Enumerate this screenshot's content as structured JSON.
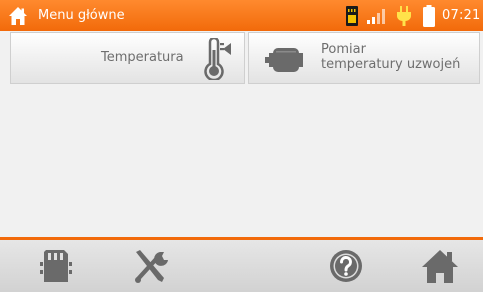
{
  "status_bar": {
    "title": "Menu główne",
    "time": "07:21",
    "icons": [
      "home-icon",
      "sd-card-icon",
      "signal-icon",
      "plug-icon",
      "battery-icon"
    ]
  },
  "menu": {
    "items": [
      {
        "label": "Temperatura",
        "icon": "thermometer-icon"
      },
      {
        "label_line1": "Pomiar",
        "label_line2": "temperatury uzwojeń",
        "icon": "motor-icon"
      }
    ]
  },
  "bottom_bar": {
    "buttons": [
      "memory-card-icon",
      "tools-icon",
      "help-icon",
      "home-icon"
    ]
  },
  "colors": {
    "accent": "#f26a0a",
    "icon_gray": "#6a6a6a",
    "text_gray": "#6e6e6e"
  }
}
